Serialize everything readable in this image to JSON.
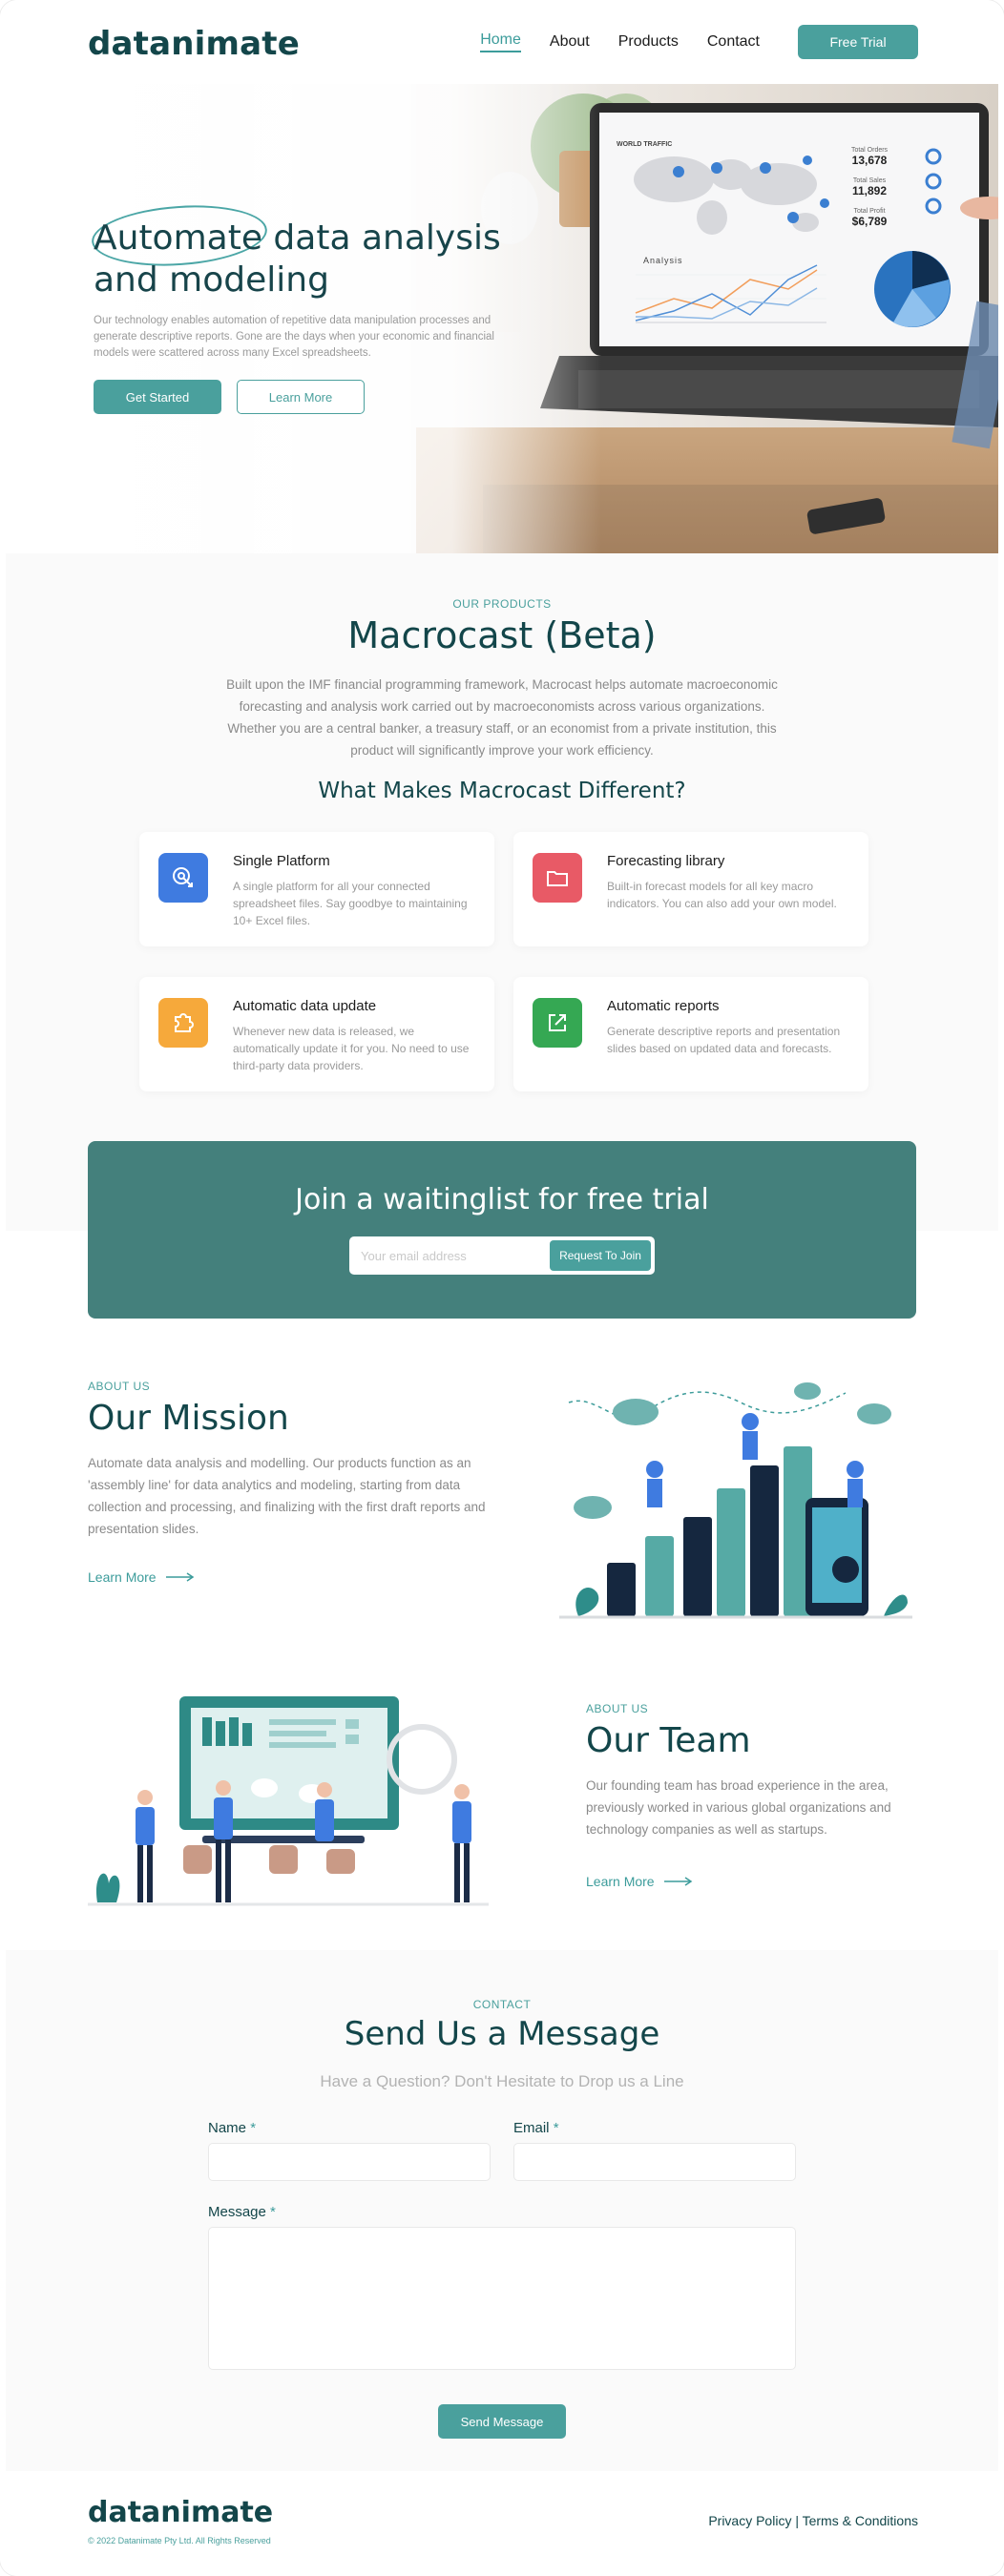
{
  "header": {
    "logo": "datanimate",
    "nav": [
      "Home",
      "About",
      "Products",
      "Contact"
    ],
    "cta": "Free Trial"
  },
  "hero": {
    "title": "Automate data analysis and modeling",
    "body": "Our technology enables automation of repetitive data manipulation processes and generate descriptive reports. Gone are the days when your economic and financial models were scattered across many Excel spreadsheets.",
    "primary": "Get Started",
    "secondary": "Learn More",
    "laptop": {
      "map_label": "WORLD TRAFFIC",
      "stats": [
        {
          "label": "Total Orders",
          "value": "13,678"
        },
        {
          "label": "Total Sales",
          "value": "11,892"
        },
        {
          "label": "Total Profit",
          "value": "$6,789"
        }
      ],
      "chart_label": "Analysis"
    }
  },
  "products": {
    "eyebrow": "OUR PRODUCTS",
    "title": "Macrocast (Beta)",
    "description": "Built upon the IMF financial programming framework, Macrocast helps automate macroeconomic forecasting and analysis work carried out by macroeconomists across various organizations. Whether you are a central banker, a treasury staff, or an economist from a private institution, this product will significantly improve your work efficiency.",
    "subtitle": "What Makes Macrocast Different?",
    "features": [
      {
        "title": "Single Platform",
        "text": "A single platform for all your connected spreadsheet files. Say goodbye to maintaining 10+ Excel files.",
        "icon": "cursor-click-icon",
        "color": "#3f7be0"
      },
      {
        "title": "Forecasting library",
        "text": "Built-in forecast models for all key macro indicators. You can also add your own model.",
        "icon": "folder-icon",
        "color": "#e85a66"
      },
      {
        "title": "Automatic data update",
        "text": "Whenever new data is released, we automatically update it for you. No need to use third-party data providers.",
        "icon": "puzzle-icon",
        "color": "#f6a93b"
      },
      {
        "title": "Automatic reports",
        "text": "Generate descriptive reports and presentation slides based on updated data and forecasts.",
        "icon": "export-icon",
        "color": "#35a853"
      }
    ]
  },
  "waitlist": {
    "title": "Join a waitinglist for free trial",
    "placeholder": "Your email address",
    "button": "Request To Join"
  },
  "mission": {
    "eyebrow": "ABOUT US",
    "title": "Our Mission",
    "text": "Automate data analysis and modelling. Our products function as an 'assembly line' for data analytics and modeling, starting from data collection and processing, and finalizing with the first draft reports and presentation slides.",
    "link": "Learn More"
  },
  "team": {
    "eyebrow": "ABOUT US",
    "title": "Our Team",
    "text": "Our founding team has broad experience in the area, previously worked in various global organizations and technology companies as well as startups.",
    "link": "Learn More"
  },
  "contact": {
    "eyebrow": "CONTACT",
    "title": "Send Us a Message",
    "subtitle": "Have a Question? Don't Hesitate to Drop us a Line",
    "name_label": "Name",
    "email_label": "Email",
    "message_label": "Message",
    "required": "*",
    "button": "Send Message"
  },
  "footer": {
    "logo": "datanimate",
    "copyright": "© 2022 Datanimate Pty Ltd. All Rights Reserved",
    "links": "Privacy Policy | Terms & Conditions"
  }
}
